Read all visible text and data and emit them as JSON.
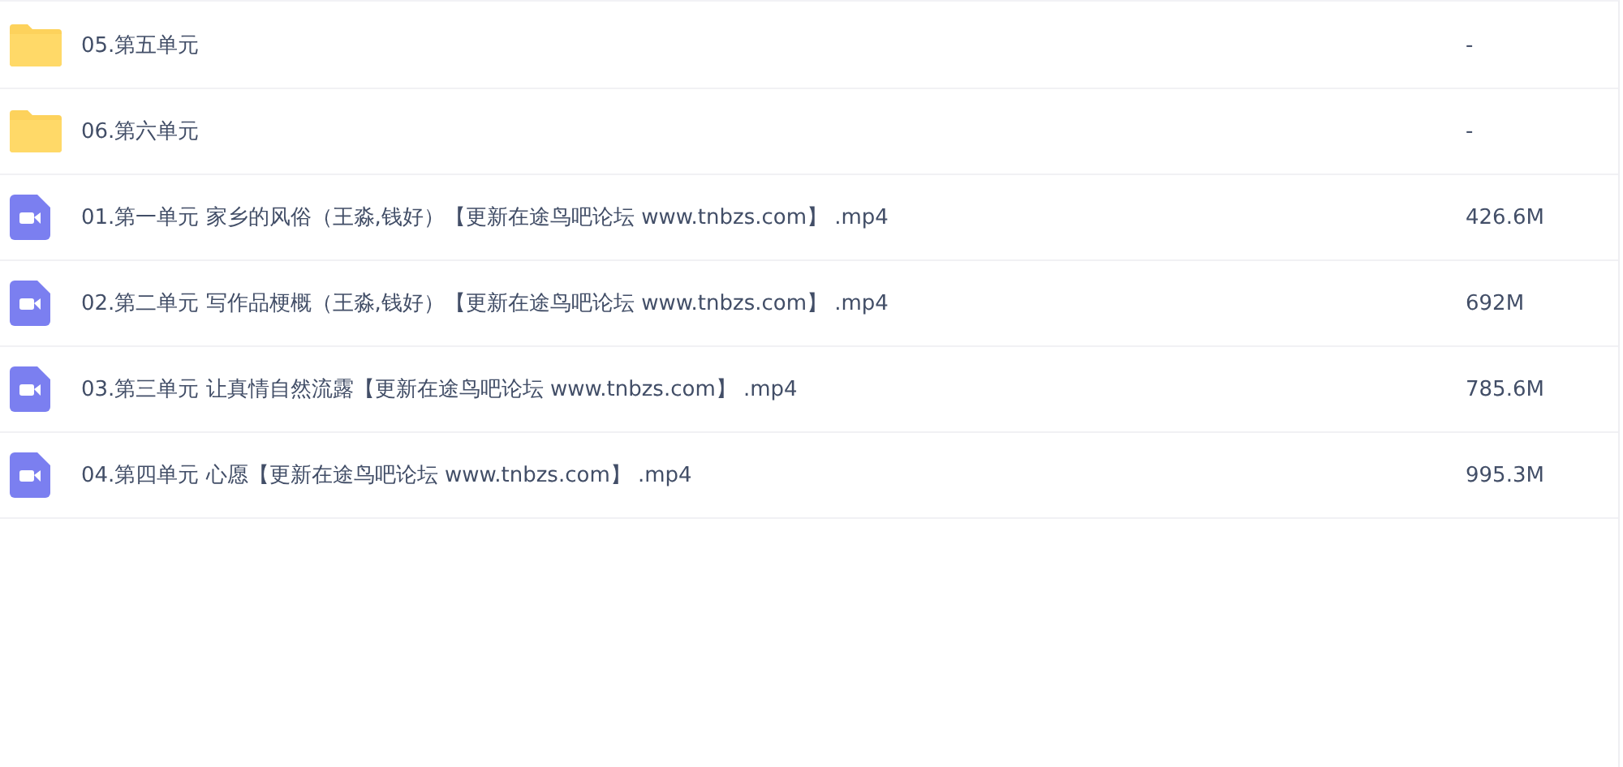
{
  "files": [
    {
      "kind": "folder",
      "name": "05.第五单元",
      "size": "-"
    },
    {
      "kind": "folder",
      "name": "06.第六单元",
      "size": "-"
    },
    {
      "kind": "video",
      "name": "01.第一单元 家乡的风俗（王淼,钱好）【更新在途鸟吧论坛 www.tnbzs.com】 .mp4",
      "size": "426.6M"
    },
    {
      "kind": "video",
      "name": "02.第二单元 写作品梗概（王淼,钱好）【更新在途鸟吧论坛 www.tnbzs.com】 .mp4",
      "size": "692M"
    },
    {
      "kind": "video",
      "name": "03.第三单元 让真情自然流露【更新在途鸟吧论坛 www.tnbzs.com】 .mp4",
      "size": "785.6M"
    },
    {
      "kind": "video",
      "name": "04.第四单元 心愿【更新在途鸟吧论坛 www.tnbzs.com】 .mp4",
      "size": "995.3M"
    }
  ]
}
